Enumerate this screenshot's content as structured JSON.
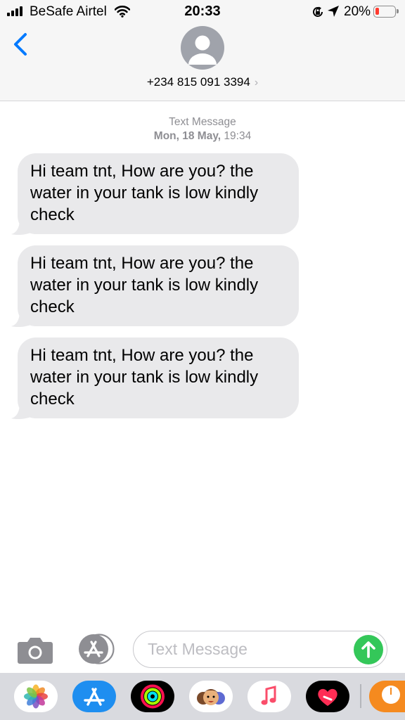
{
  "status_bar": {
    "carrier": "BeSafe Airtel",
    "time": "20:33",
    "battery_percent": "20%",
    "battery_level": 0.2,
    "battery_color": "#ff3b30"
  },
  "header": {
    "back_icon": "chevron-left-icon",
    "contact_number": "+234 815 091 3394",
    "contact_chevron": "›"
  },
  "conversation": {
    "service_label": "Text Message",
    "date_label": "Mon, 18 May,",
    "time_label": "19:34",
    "messages": [
      {
        "direction": "incoming",
        "text": "Hi team tnt, How are you? the water in your tank is low kindly check"
      },
      {
        "direction": "incoming",
        "text": "Hi team tnt, How are you? the water in your tank is low kindly check"
      },
      {
        "direction": "incoming",
        "text": "Hi team tnt, How are you? the water in your tank is low kindly check"
      }
    ]
  },
  "composer": {
    "placeholder": "Text Message",
    "send_color": "#34c759",
    "icons": [
      "camera-icon",
      "app-store-icon",
      "send-arrow-icon"
    ]
  },
  "app_drawer": {
    "apps": [
      "photos-icon",
      "app-store-icon",
      "activity-icon",
      "memoji-icon",
      "music-icon",
      "heart-app-icon",
      "partial-app-icon"
    ]
  },
  "colors": {
    "accent": "#007aff",
    "bubble_incoming": "#e9e9eb",
    "secondary_text": "#8e8e93"
  }
}
